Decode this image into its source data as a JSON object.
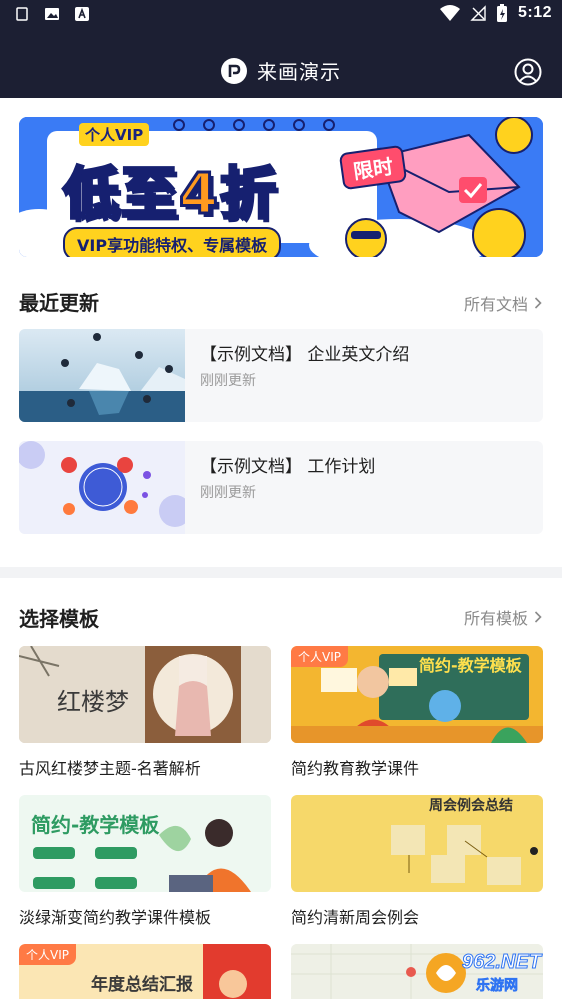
{
  "status_bar": {
    "time": "5:12"
  },
  "app": {
    "title": "来画演示"
  },
  "banner": {
    "label": "个人VIP",
    "headline_pre": "低至",
    "headline_num": "4",
    "headline_post": "折",
    "tag": "限时",
    "subtitle": "VIP享功能特权、专属模板"
  },
  "recent": {
    "title": "最近更新",
    "more_label": "所有文档",
    "items": [
      {
        "name": "【示例文档】 企业英文介绍",
        "time": "刚刚更新"
      },
      {
        "name": "【示例文档】 工作计划",
        "time": "刚刚更新"
      }
    ]
  },
  "templates": {
    "title": "选择模板",
    "more_label": "所有模板",
    "items": [
      {
        "name": "古风红楼梦主题-名著解析",
        "thumb_text": "红楼梦",
        "vip": ""
      },
      {
        "name": "简约教育教学课件",
        "thumb_text": "简约-教学模板",
        "vip": "个人VIP"
      },
      {
        "name": "淡绿渐变简约教学课件模板",
        "thumb_text": "简约-教学模板",
        "vip": ""
      },
      {
        "name": "简约清新周会例会",
        "thumb_text": "周会例会总结",
        "vip": ""
      },
      {
        "name": "",
        "thumb_text": "年度总结汇报",
        "vip": "个人VIP"
      },
      {
        "name": "",
        "thumb_text": "",
        "vip": ""
      }
    ]
  },
  "watermark": {
    "brand": "962.NET",
    "sub": "乐游网"
  },
  "colors": {
    "topbar": "#1c1f33",
    "banner": "#2f74f2",
    "vip": "#ff7a45",
    "muted": "#8a8a8a"
  }
}
